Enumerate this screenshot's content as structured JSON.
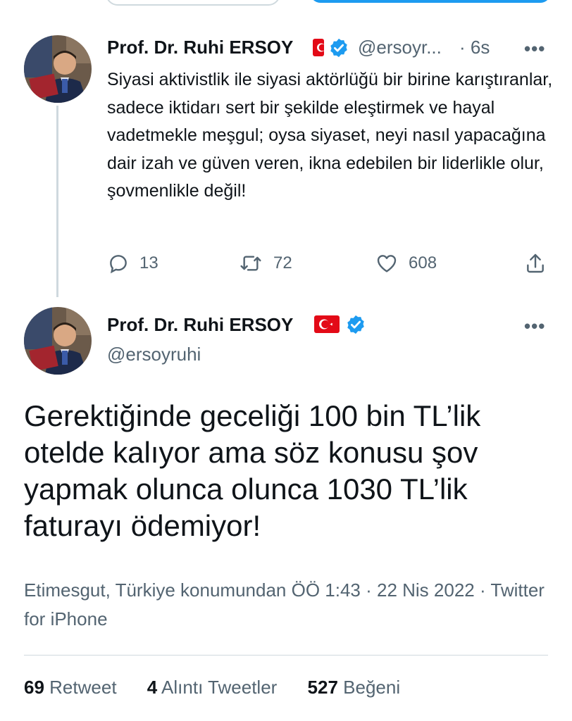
{
  "tweet1": {
    "name": "Prof. Dr. Ruhi ERSOY",
    "handle": "@ersoyr...",
    "time": "· 6s",
    "more": "•••",
    "text": "Siyasi aktivistlik ile siyasi aktörlüğü bir birine karıştıranlar, sadece iktidarı sert bir şekilde eleştirmek  ve hayal vadetmekle meşgul; oysa siyaset, neyi nasıl yapacağına dair izah ve güven veren, ikna edebilen bir liderlikle olur, şovmenlikle değil!",
    "replies": "13",
    "retweets": "72",
    "likes": "608"
  },
  "tweet2": {
    "name": "Prof. Dr. Ruhi ERSOY",
    "handle": "@ersoyruhi",
    "more": "•••",
    "text": "Gerektiğinde  geceliği 100 bin TL’lik otelde kalıyor ama söz konusu şov yapmak olunca olunca 1030 TL’lik faturayı ödemiyor!",
    "meta": "Etimesgut, Türkiye konumundan ÖÖ 1:43 · 22 Nis 2022 · Twitter for iPhone",
    "retweet_count": "69",
    "retweet_label": "Retweet",
    "quote_count": "4",
    "quote_label": "Alıntı Tweetler",
    "like_count": "527",
    "like_label": "Beğeni"
  },
  "colors": {
    "accent": "#1d9bf0",
    "text": "#0f1419",
    "secondary": "#536471",
    "flag_red": "#e30a17"
  },
  "icons": [
    "reply-icon",
    "retweet-icon",
    "like-icon",
    "share-icon",
    "verified-icon",
    "flag-icon",
    "more-icon"
  ]
}
